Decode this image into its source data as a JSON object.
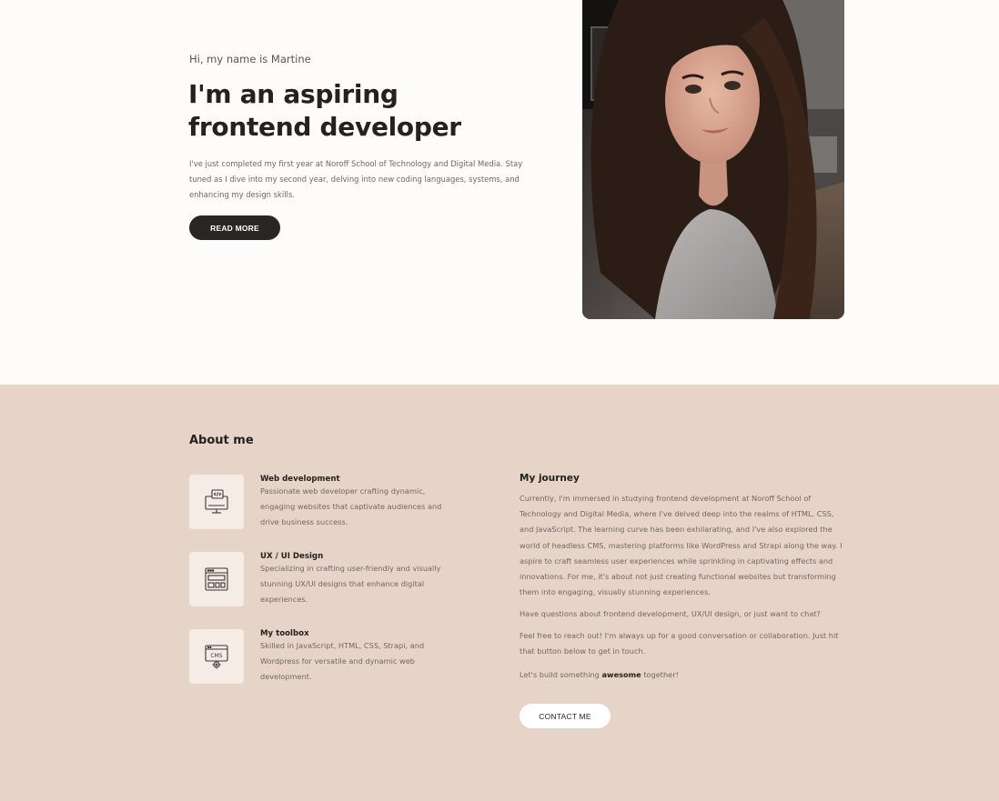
{
  "hero": {
    "greeting": "Hi, my name is Martine",
    "headline": "I'm an aspiring frontend developer",
    "intro": "I've just completed my first year at Noroff School of Technology and Digital Media. Stay tuned as I dive into my second year, delving into new coding languages, systems, and enhancing my design skills.",
    "read_more_label": "READ MORE"
  },
  "about": {
    "title": "About me",
    "skills": [
      {
        "icon": "computer-code-icon",
        "title": "Web development",
        "description": "Passionate web developer crafting dynamic, engaging websites that captivate audiences and drive business success."
      },
      {
        "icon": "browser-layout-icon",
        "title": "UX / UI Design",
        "description": "Specializing in crafting user-friendly and visually stunning UX/UI designs that enhance digital experiences."
      },
      {
        "icon": "cms-gear-icon",
        "title": "My toolbox",
        "description": "Skilled in JavaScript, HTML, CSS, Strapi, and Wordpress for versatile and dynamic web development."
      }
    ],
    "journey": {
      "title": "My journey",
      "paragraph1": "Currently, I'm immersed in studying frontend development at Noroff School of Technology and Digital Media, where I've delved deep into the realms of HTML, CSS, and JavaScript. The learning curve has been exhilarating, and I've also explored the world of headless CMS, mastering platforms like WordPress and Strapi along the way. I aspire to craft seamless user experiences while sprinkling in captivating effects and innovations. For me, it's about not just creating functional websites but transforming them into engaging, visually stunning experiences.",
      "paragraph2": "Have questions about frontend development, UX/UI design, or just want to chat?",
      "paragraph3": "Feel free to reach out! I'm always up for a good conversation or collaboration. Just hit that button below to get in touch.",
      "closing_prefix": "Let's build something ",
      "closing_bold": "awesome",
      "closing_suffix": " together!"
    },
    "contact_label": "CONTACT ME"
  }
}
